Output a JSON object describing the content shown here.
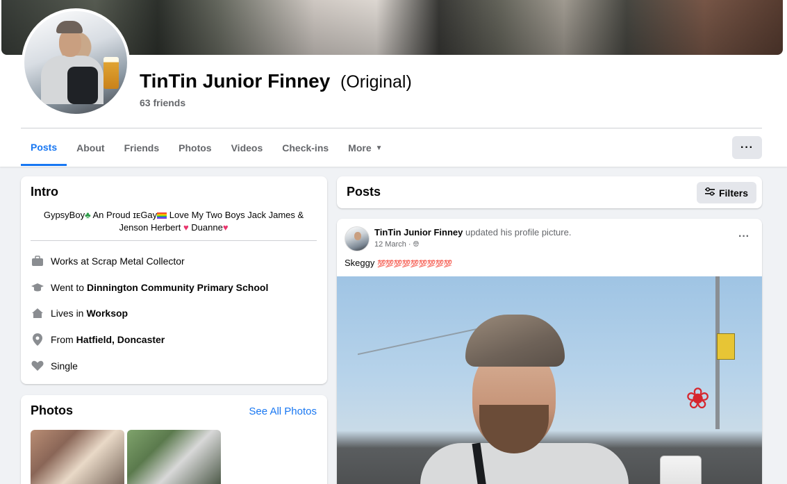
{
  "profile": {
    "name": "TinTin Junior Finney",
    "name_suffix": "(Original)",
    "friends_count": "63 friends"
  },
  "tabs": [
    {
      "label": "Posts",
      "active": true
    },
    {
      "label": "About"
    },
    {
      "label": "Friends"
    },
    {
      "label": "Photos"
    },
    {
      "label": "Videos"
    },
    {
      "label": "Check-ins"
    },
    {
      "label": "More"
    }
  ],
  "more_menu_icon": "ellipsis-icon",
  "accent_color": "#1877f2",
  "intro": {
    "title": "Intro",
    "bio": {
      "part1": "GypsyBoy",
      "part2": " An Proud ɪᴇGay",
      "part3": " Love My Two Boys Jack James & Jenson Herbert ",
      "part4": " Duanne"
    },
    "details": [
      {
        "icon": "briefcase-icon",
        "prefix": "Works at Scrap Metal Collector",
        "bold": ""
      },
      {
        "icon": "graduation-cap-icon",
        "prefix": "Went to",
        "bold": "Dinnington Community Primary School"
      },
      {
        "icon": "home-icon",
        "prefix": "Lives in",
        "bold": "Worksop"
      },
      {
        "icon": "location-pin-icon",
        "prefix": "From",
        "bold": "Hatfield, Doncaster"
      },
      {
        "icon": "heart-icon",
        "prefix": "Single",
        "bold": ""
      }
    ]
  },
  "photos": {
    "title": "Photos",
    "see_all": "See All Photos"
  },
  "posts": {
    "title": "Posts",
    "filters_label": "Filters"
  },
  "post": {
    "author": "TinTin Junior Finney",
    "action": " updated his profile picture.",
    "date": "12 March · ",
    "text": "Skeggy ",
    "emoji_100": "💯💯💯💯💯💯💯💯💯"
  }
}
